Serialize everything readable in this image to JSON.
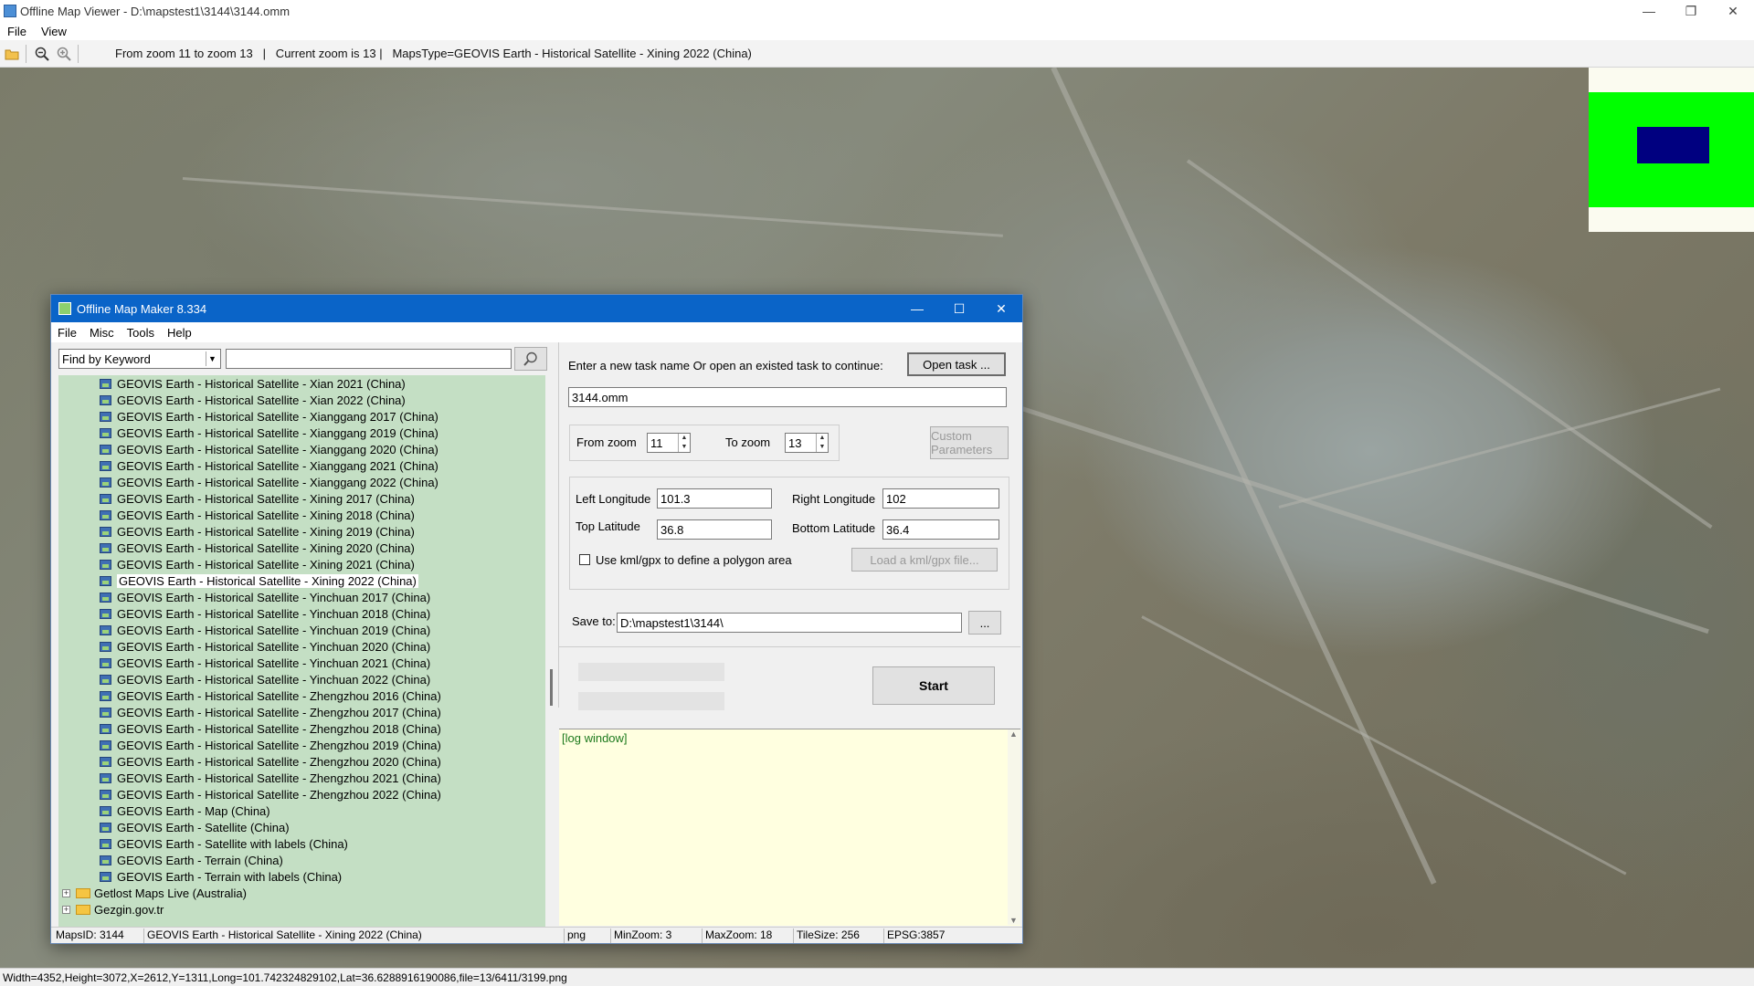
{
  "window": {
    "title": "Offline Map Viewer - D:\\mapstest1\\3144\\3144.omm",
    "minimize": "—",
    "maximize": "❐",
    "close": "✕"
  },
  "menu": {
    "file": "File",
    "view": "View"
  },
  "toolbar": {
    "info": "From zoom 11 to zoom 13   |   Current zoom is 13 |   MapsType=GEOVIS Earth - Historical Satellite - Xining 2022 (China)"
  },
  "statusbar": {
    "text": "Width=4352,Height=3072,X=2612,Y=1311,Long=101.742324829102,Lat=36.6288916190086,file=13/6411/3199.png"
  },
  "dialog": {
    "title": "Offline Map Maker 8.334",
    "minimize": "—",
    "maximize": "☐",
    "close": "✕",
    "menu": {
      "file": "File",
      "misc": "Misc",
      "tools": "Tools",
      "help": "Help"
    },
    "search": {
      "mode": "Find by Keyword",
      "query": ""
    },
    "tree_items": [
      "GEOVIS Earth - Historical Satellite - Xian 2021 (China)",
      "GEOVIS Earth - Historical Satellite - Xian 2022 (China)",
      "GEOVIS Earth - Historical Satellite - Xianggang 2017 (China)",
      "GEOVIS Earth - Historical Satellite - Xianggang 2019 (China)",
      "GEOVIS Earth - Historical Satellite - Xianggang 2020 (China)",
      "GEOVIS Earth - Historical Satellite - Xianggang 2021 (China)",
      "GEOVIS Earth - Historical Satellite - Xianggang 2022 (China)",
      "GEOVIS Earth - Historical Satellite - Xining 2017 (China)",
      "GEOVIS Earth - Historical Satellite - Xining 2018 (China)",
      "GEOVIS Earth - Historical Satellite - Xining 2019 (China)",
      "GEOVIS Earth - Historical Satellite - Xining 2020 (China)",
      "GEOVIS Earth - Historical Satellite - Xining 2021 (China)",
      "GEOVIS Earth - Historical Satellite - Xining 2022 (China)",
      "GEOVIS Earth - Historical Satellite - Yinchuan 2017 (China)",
      "GEOVIS Earth - Historical Satellite - Yinchuan 2018 (China)",
      "GEOVIS Earth - Historical Satellite - Yinchuan 2019 (China)",
      "GEOVIS Earth - Historical Satellite - Yinchuan 2020 (China)",
      "GEOVIS Earth - Historical Satellite - Yinchuan 2021 (China)",
      "GEOVIS Earth - Historical Satellite - Yinchuan 2022 (China)",
      "GEOVIS Earth - Historical Satellite - Zhengzhou 2016 (China)",
      "GEOVIS Earth - Historical Satellite - Zhengzhou 2017 (China)",
      "GEOVIS Earth - Historical Satellite - Zhengzhou 2018 (China)",
      "GEOVIS Earth - Historical Satellite - Zhengzhou 2019 (China)",
      "GEOVIS Earth - Historical Satellite - Zhengzhou 2020 (China)",
      "GEOVIS Earth - Historical Satellite - Zhengzhou 2021 (China)",
      "GEOVIS Earth - Historical Satellite - Zhengzhou 2022 (China)",
      "GEOVIS Earth - Map (China)",
      "GEOVIS Earth - Satellite (China)",
      "GEOVIS Earth - Satellite with labels (China)",
      "GEOVIS Earth - Terrain (China)",
      "GEOVIS Earth - Terrain with labels (China)"
    ],
    "tree_folders": [
      "Getlost Maps Live (Australia)",
      "Gezgin.gov.tr"
    ],
    "task": {
      "prompt": "Enter a new task name Or open an existed task to continue:",
      "open_label": "Open task ...",
      "name": "3144.omm"
    },
    "zoom": {
      "from_label": "From zoom",
      "from_value": "11",
      "to_label": "To zoom",
      "to_value": "13",
      "custom_label": "Custom Parameters"
    },
    "area": {
      "left_lon_label": "Left Longitude",
      "left_lon": "101.3",
      "right_lon_label": "Right Longitude",
      "right_lon": "102",
      "top_lat_label": "Top Latitude",
      "top_lat": "36.8",
      "bottom_lat_label": "Bottom Latitude",
      "bottom_lat": "36.4",
      "kml_label": "Use kml/gpx to define a polygon area",
      "load_kml_label": "Load a kml/gpx file..."
    },
    "save": {
      "label": "Save to:",
      "path": "D:\\mapstest1\\3144\\",
      "browse": "..."
    },
    "start_label": "Start",
    "log_label": "[log window]",
    "status": {
      "maps_id": "MapsID: 3144",
      "maps_name": "GEOVIS Earth - Historical Satellite - Xining 2022 (China)",
      "format": "png",
      "min_zoom": "MinZoom: 3",
      "max_zoom": "MaxZoom: 18",
      "tile_size": "TileSize: 256",
      "epsg": "EPSG:3857"
    }
  },
  "colors": {
    "dialog_title": "#0a64c8",
    "tree_bg": "#c4dfc4",
    "log_bg": "#ffffe0",
    "minimap_green": "#00ff00",
    "minimap_blue": "#000080"
  }
}
